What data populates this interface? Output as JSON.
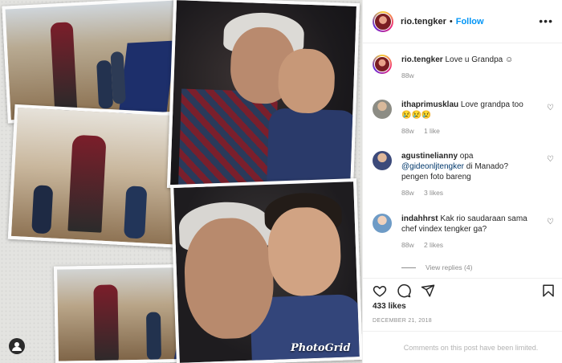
{
  "post": {
    "username": "rio.tengker",
    "separator": "•",
    "follow_label": "Follow",
    "more_label": "•••",
    "watermark": "PhotoGrid"
  },
  "caption": {
    "username": "rio.tengker",
    "text": "Love u Grandpa ☺",
    "age": "88w"
  },
  "comments": [
    {
      "username": "ithaprimusklau",
      "text": "Love grandpa too 😢😢😢",
      "age": "88w",
      "likes": "1 like",
      "reply": ""
    },
    {
      "username": "agustinelianny",
      "text_before": "opa",
      "mention": "@gideonljtengker",
      "text_after": "di Manado? pengen foto bareng",
      "age": "88w",
      "likes": "3 likes",
      "reply": ""
    },
    {
      "username": "indahhrst",
      "text": "Kak rio saudaraan sama chef vindex tengker ga?",
      "age": "88w",
      "likes": "2 likes",
      "reply": ""
    }
  ],
  "view_replies": "View replies (4)",
  "icons": {
    "heart": "heart-icon",
    "comment": "comment-icon",
    "share": "share-icon",
    "save": "bookmark-icon",
    "more": "more-options-icon",
    "profile": "profile-icon"
  },
  "likes_count": "433 likes",
  "date": "DECEMBER 21, 2018",
  "comments_limited": "Comments on this post have been limited.",
  "colors": {
    "link_blue": "#0095f6",
    "mention_blue": "#00376b",
    "text": "#262626",
    "muted": "#8e8e8e"
  }
}
